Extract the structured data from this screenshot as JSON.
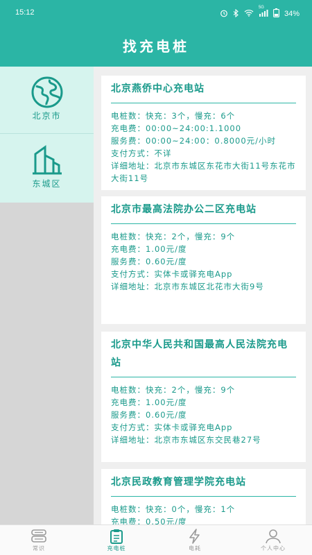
{
  "status_bar": {
    "time": "15:12",
    "icons": [
      "alarm-icon",
      "bluetooth-icon",
      "wifi-icon",
      "signal-icon",
      "battery-icon"
    ],
    "network": "5G",
    "battery": "34%"
  },
  "header": {
    "title": "找充电桩"
  },
  "sidebar": {
    "items": [
      {
        "label": "北京市",
        "icon": "globe-icon"
      },
      {
        "label": "东城区",
        "icon": "building-icon"
      }
    ]
  },
  "stations": [
    {
      "name": "北京燕侨中心充电站",
      "piles": "电桩数：快充：3个，慢充：6个",
      "charge_fee": "充电费：00:00~24:00:1.1000",
      "service_fee": "服务费：00:00~24:00：0.8000元/小时",
      "payment": "支付方式：不详",
      "address": "详细地址：北京市东城区东花市大街11号东花市大街11号"
    },
    {
      "name": "北京市最高法院办公二区充电站",
      "piles": "电桩数：快充：2个，慢充：9个",
      "charge_fee": "充电费：1.00元/度",
      "service_fee": "服务费：0.60元/度",
      "payment": "支付方式：实体卡或驿充电App",
      "address": "详细地址：北京市东城区北花市大街9号"
    },
    {
      "name": "北京中华人民共和国最高人民法院充电站",
      "piles": "电桩数：快充：2个，慢充：9个",
      "charge_fee": "充电费：1.00元/度",
      "service_fee": "服务费：0.60元/度",
      "payment": "支付方式：实体卡或驿充电App",
      "address": "详细地址：北京市东城区东交民巷27号"
    },
    {
      "name": "北京民政教育管理学院充电站",
      "piles": "电桩数：快充：0个，慢充：1个",
      "charge_fee": "充电费：0.50元/度",
      "service_fee": "",
      "payment": "",
      "address": ""
    }
  ],
  "tabbar": {
    "items": [
      {
        "label": "常识",
        "icon": "book-stack-icon",
        "active": false
      },
      {
        "label": "充电桩",
        "icon": "clipboard-icon",
        "active": true
      },
      {
        "label": "电耗",
        "icon": "lightning-icon",
        "active": false
      },
      {
        "label": "个人中心",
        "icon": "person-icon",
        "active": false
      }
    ]
  },
  "colors": {
    "primary": "#2bb5a5",
    "accent_text": "#1a9a8b",
    "sidebar_bg": "#d6f4ee"
  }
}
